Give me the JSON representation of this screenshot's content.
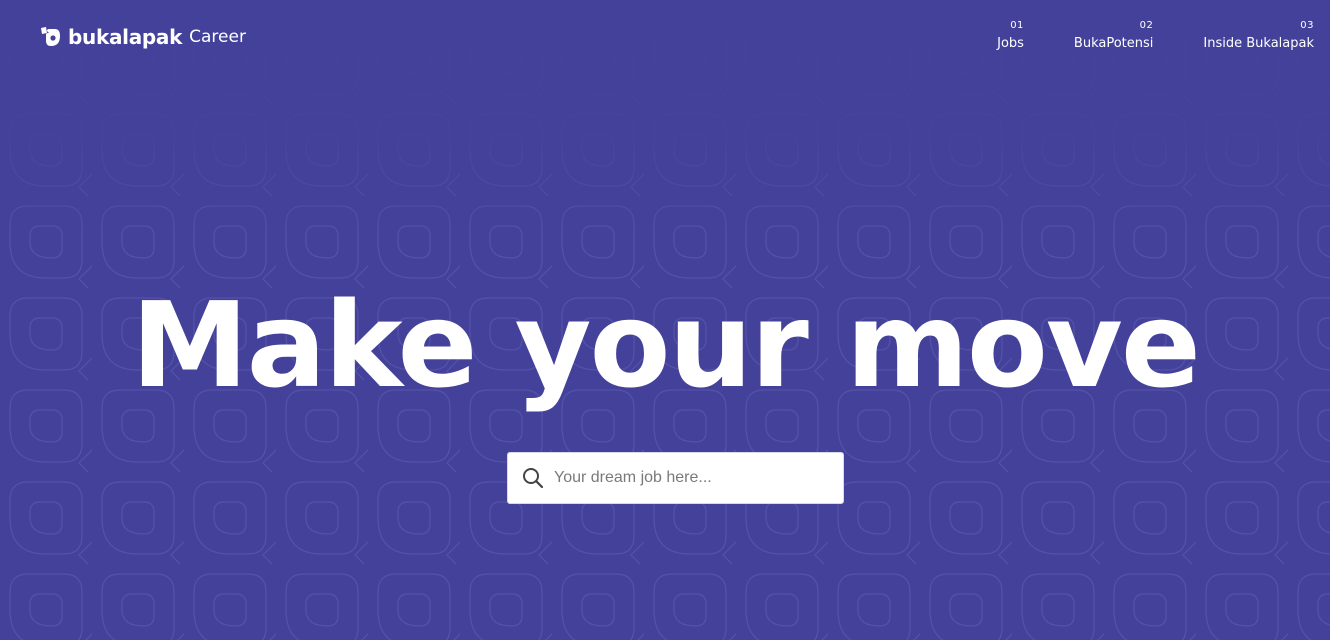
{
  "header": {
    "logo_text": "bukalapak",
    "logo_suffix": "Career",
    "nav": [
      {
        "num": "01",
        "label": "Jobs"
      },
      {
        "num": "02",
        "label": "BukaPotensi"
      },
      {
        "num": "03",
        "label": "Inside Bukalapak"
      }
    ]
  },
  "hero": {
    "title": "Make your move"
  },
  "search": {
    "placeholder": "Your dream job here...",
    "icon": "search-icon"
  },
  "colors": {
    "background": "#43419a",
    "pattern_stroke": "#5856aa",
    "text": "#ffffff",
    "search_bg": "#ffffff"
  }
}
